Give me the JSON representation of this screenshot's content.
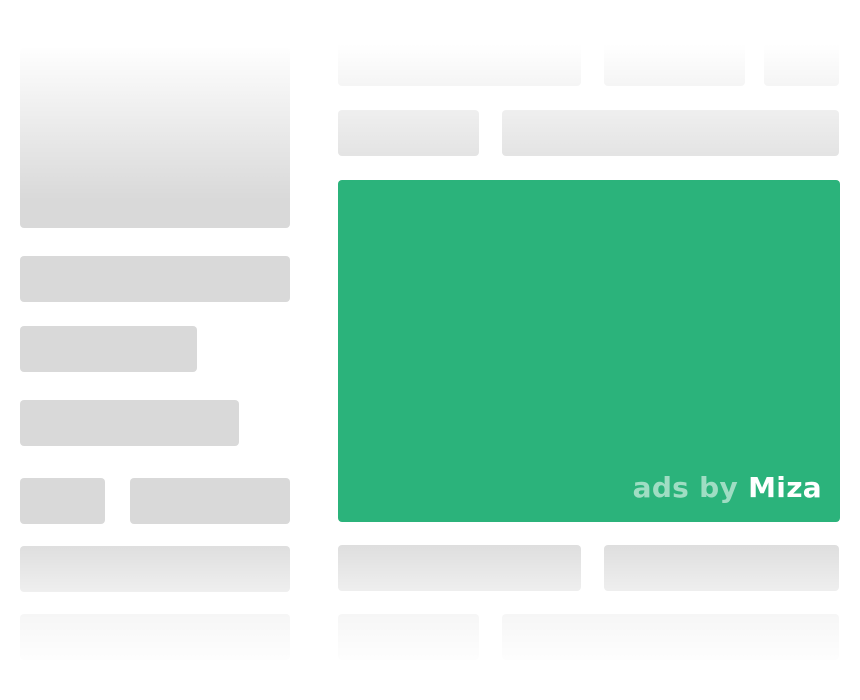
{
  "ad": {
    "prefix": "ads by",
    "brand": "Miza",
    "color": "#2bb37b"
  },
  "placeholder_color": "#d9d9d9"
}
